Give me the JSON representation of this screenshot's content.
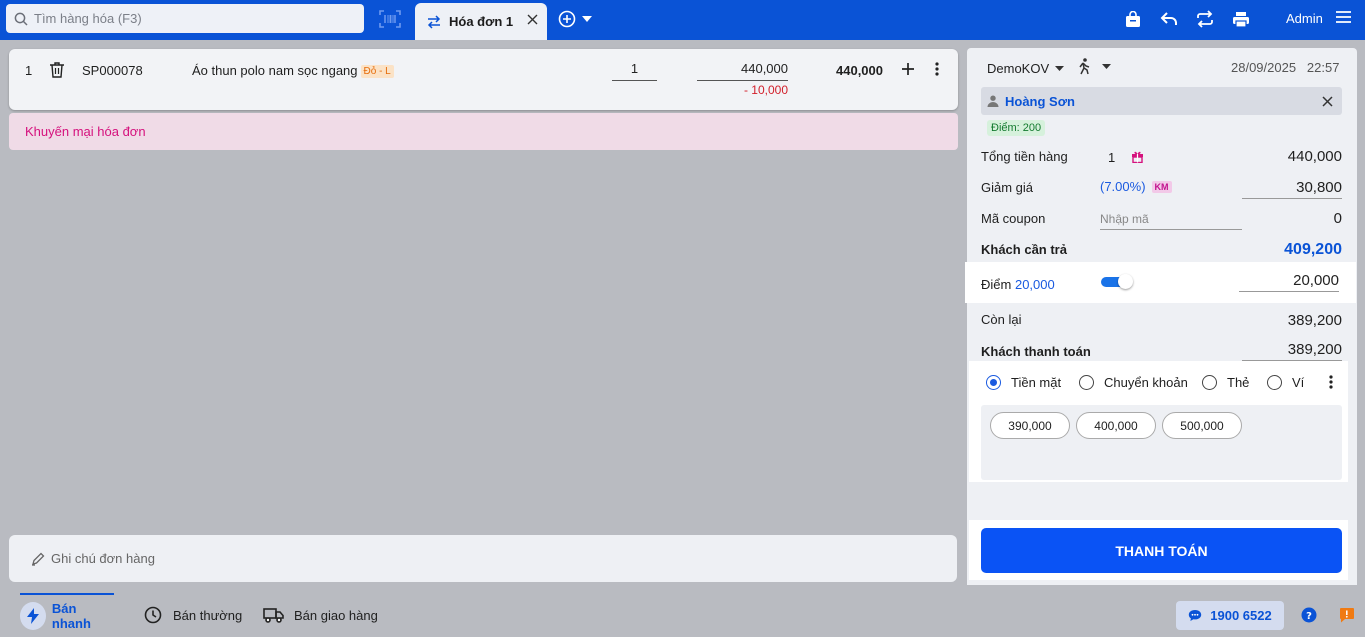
{
  "search": {
    "placeholder": "Tìm hàng hóa (F3)"
  },
  "tabs": [
    {
      "label": "Hóa đơn 1"
    }
  ],
  "header": {
    "user": "Admin"
  },
  "cart": {
    "items": [
      {
        "index": "1",
        "code": "SP000078",
        "name": "Áo thun polo nam sọc ngang",
        "variant": "Đỏ - L",
        "quantity": "1",
        "unit_price": "440,000",
        "discount": "- 10,000",
        "total": "440,000"
      }
    ],
    "promo_label": "Khuyến mại hóa đơn",
    "note_placeholder": "Ghi chú đơn hàng"
  },
  "order": {
    "branch": "DemoKOV",
    "date": "28/09/2025",
    "time": "22:57",
    "customer": {
      "name": "Hoàng Sơn",
      "points_badge": "Điểm: 200"
    },
    "total_goods": {
      "label": "Tổng tiền hàng",
      "count": "1",
      "value": "440,000"
    },
    "discount": {
      "label": "Giảm giá",
      "percent": "(7.00%)",
      "badge": "KM",
      "value": "30,800"
    },
    "coupon": {
      "label": "Mã coupon",
      "placeholder": "Nhập mã",
      "value": "0"
    },
    "customer_pays": {
      "label": "Khách cần trả",
      "value": "409,200"
    },
    "points": {
      "label": "Điểm",
      "amount": "20,000",
      "value": "20,000",
      "enabled": true
    },
    "remaining": {
      "label": "Còn lại",
      "value": "389,200"
    },
    "customer_paid": {
      "label": "Khách thanh toán",
      "value": "389,200"
    }
  },
  "payment": {
    "methods": [
      "Tiền mặt",
      "Chuyển khoản",
      "Thẻ",
      "Ví"
    ],
    "selected": "Tiền mặt",
    "quick_amounts": [
      "390,000",
      "400,000",
      "500,000"
    ],
    "checkout_label": "THANH TOÁN"
  },
  "footer": {
    "modes": [
      "Bán nhanh",
      "Bán thường",
      "Bán giao hàng"
    ],
    "active_mode": "Bán nhanh",
    "hotline": "1900 6522"
  },
  "colors": {
    "brand_blue": "#0a53d6",
    "checkout_blue": "#0a53f5",
    "promo_pink": "#d5117d",
    "discount_red": "#d2202b",
    "variant_orange": "#e66c0a"
  }
}
